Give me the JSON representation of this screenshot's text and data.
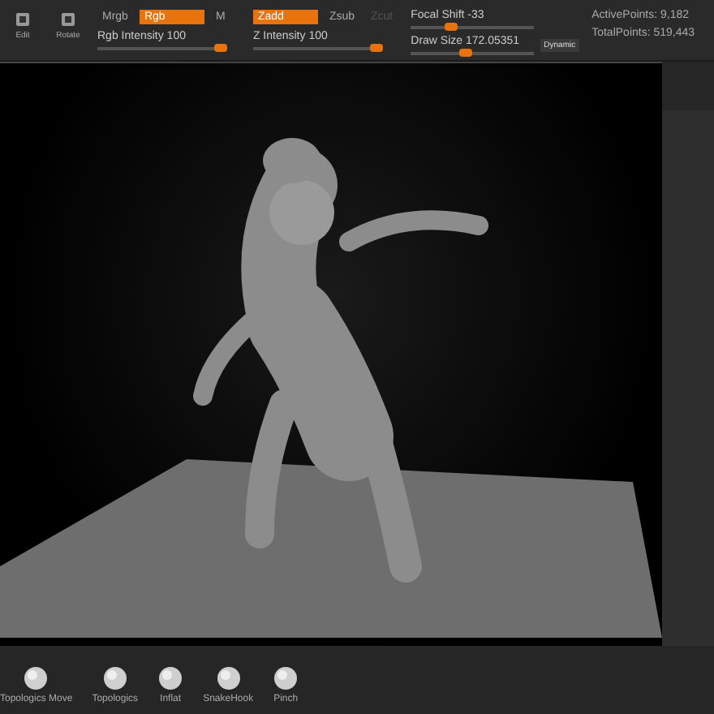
{
  "toolbar": {
    "tools": [
      {
        "label": "Edit"
      },
      {
        "label": "Rotate"
      }
    ],
    "rgb_toggles": [
      {
        "label": "Mrgb",
        "selected": false
      },
      {
        "label": "Rgb",
        "selected": true
      },
      {
        "label": "M",
        "selected": false
      }
    ],
    "z_toggles": [
      {
        "label": "Zadd",
        "selected": true,
        "disabled": false
      },
      {
        "label": "Zsub",
        "selected": false,
        "disabled": false
      },
      {
        "label": "Zcut",
        "selected": false,
        "disabled": true
      }
    ],
    "sliders": [
      {
        "label": "Rgb Intensity 100",
        "level": 1.0
      },
      {
        "label": "Z Intensity 100",
        "level": 1.0
      },
      {
        "label": "Focal Shift -33",
        "level": 0.33
      },
      {
        "label": "Draw Size 172.05351",
        "level": 0.45
      }
    ],
    "dynamic_button": "Dynamic",
    "stats": [
      "ActivePoints: 9,182",
      "TotalPoints: 519,443"
    ]
  },
  "brushes": [
    {
      "label": "Topologics Move"
    },
    {
      "label": "Topologics"
    },
    {
      "label": "Inflat"
    },
    {
      "label": "SnakeHook"
    },
    {
      "label": "Pinch"
    }
  ]
}
